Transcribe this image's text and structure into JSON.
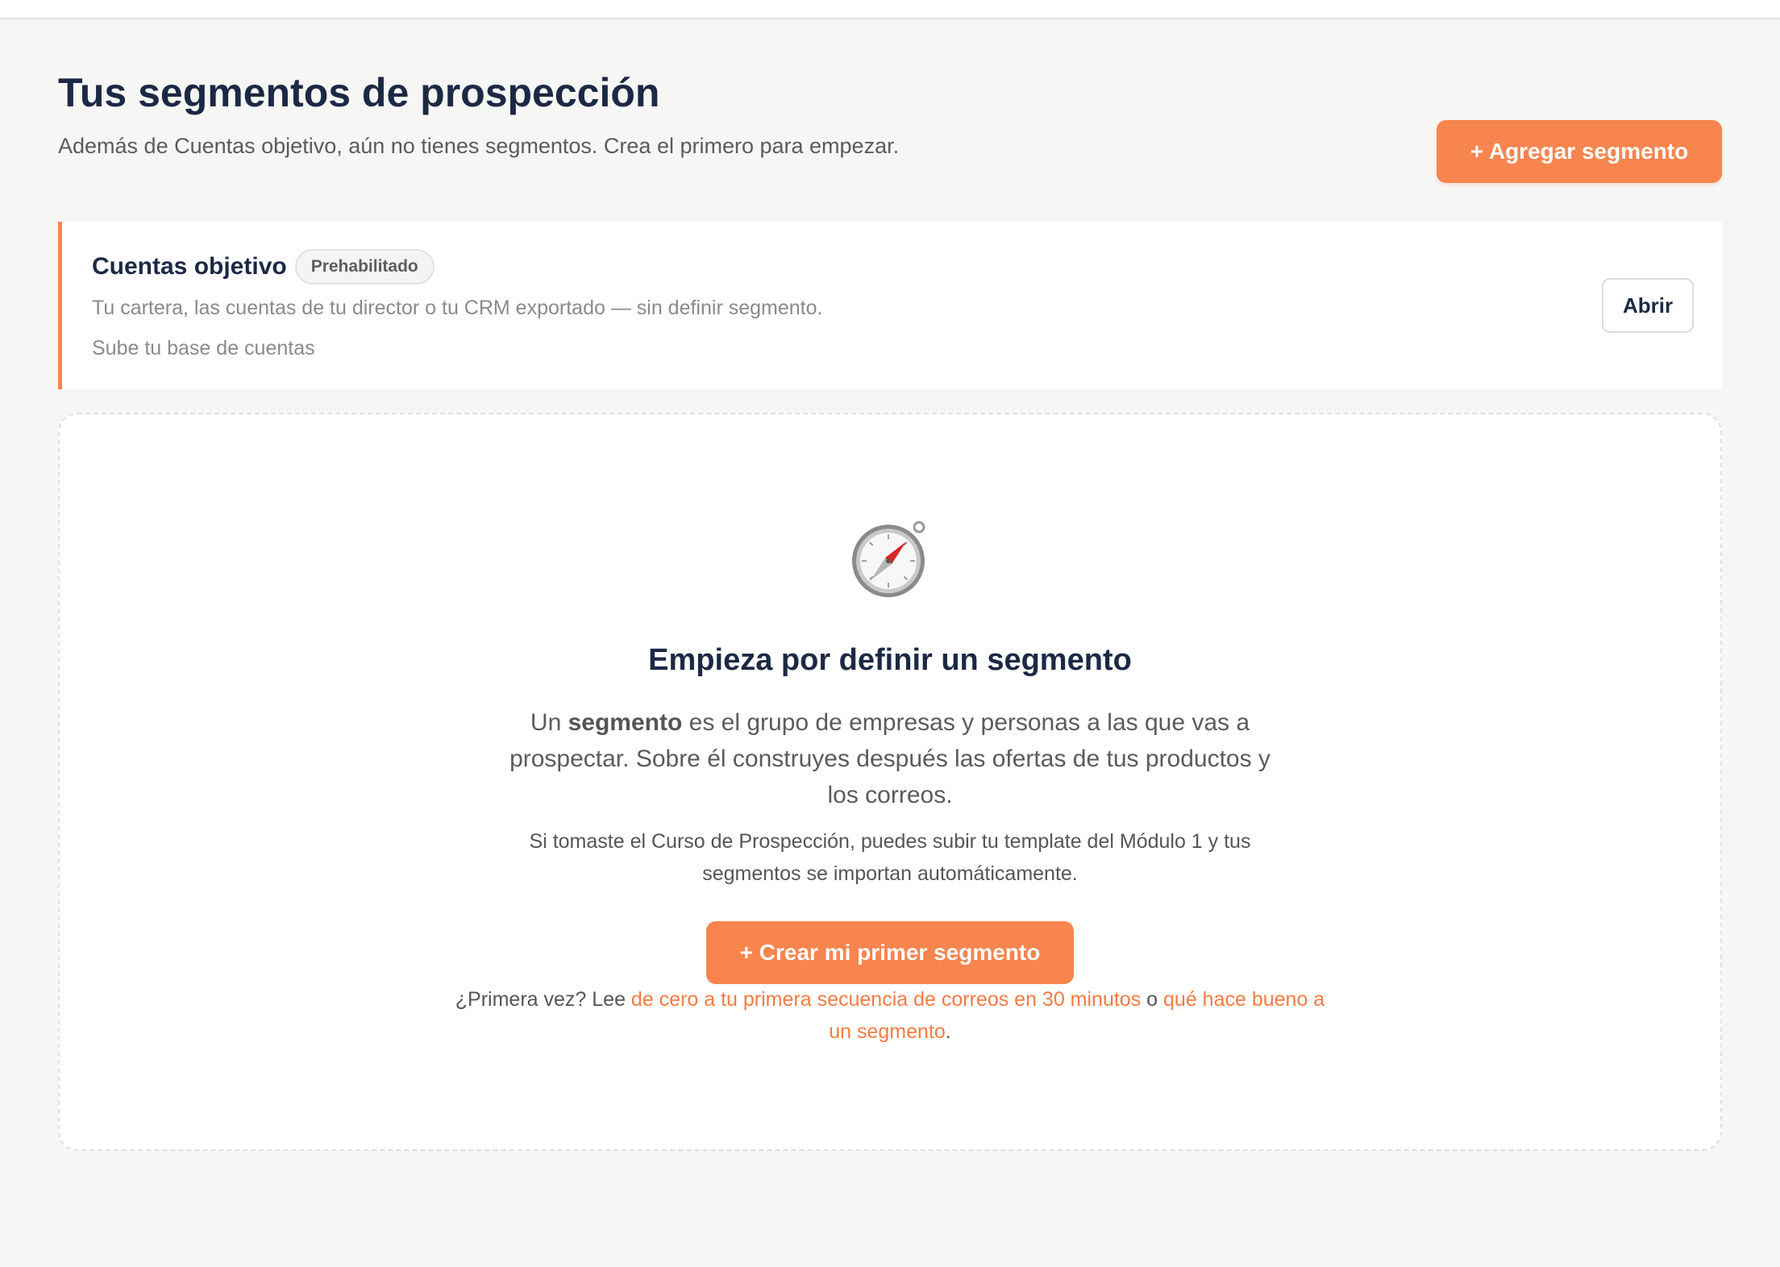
{
  "header": {
    "title": "Tus segmentos de prospección",
    "subtitle": "Además de Cuentas objetivo, aún no tienes segmentos. Crea el primero para empezar.",
    "add_button_label": "+ Agregar segmento"
  },
  "target_accounts": {
    "title": "Cuentas objetivo",
    "badge": "Prehabilitado",
    "description": "Tu cartera, las cuentas de tu director o tu CRM exportado — sin definir segmento.",
    "cta_text": "Sube tu base de cuentas",
    "open_button_label": "Abrir"
  },
  "empty_state": {
    "icon": "compass-icon",
    "title": "Empieza por definir un segmento",
    "body_prefix": "Un ",
    "body_bold": "segmento",
    "body_suffix": " es el grupo de empresas y personas a las que vas a prospectar. Sobre él construyes después las ofertas de tus productos y los correos.",
    "note": "Si tomaste el Curso de Prospección, puedes subir tu template del Módulo 1 y tus segmentos se importan automáticamente.",
    "create_button_label": "+ Crear mi primer segmento",
    "help_prefix": "¿Primera vez? Lee ",
    "help_link_1": "de cero a tu primera secuencia de correos en 30 minutos",
    "help_middle": " o ",
    "help_link_2": "qué hace bueno a un segmento",
    "help_suffix": "."
  },
  "colors": {
    "accent": "#f8844e",
    "heading": "#1c2945",
    "muted": "#8a8a8a",
    "background": "#f6f6f5"
  }
}
